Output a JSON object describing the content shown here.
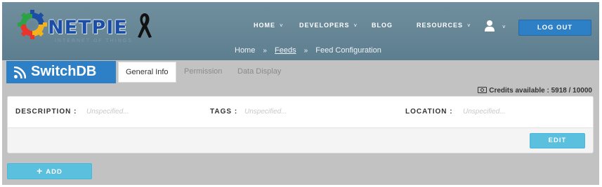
{
  "header": {
    "logo": {
      "text": "NETPIE",
      "tagline": "INTERNET OF THINGS"
    },
    "nav": [
      {
        "label": "HOME",
        "has_dropdown": true
      },
      {
        "label": "DEVELOPERS",
        "has_dropdown": true
      },
      {
        "label": "BLOG",
        "has_dropdown": false
      },
      {
        "label": "RESOURCES",
        "has_dropdown": true
      }
    ],
    "dropdown_caret": "˅",
    "user_icon": "user-icon",
    "logout_label": "LOG OUT"
  },
  "breadcrumb": {
    "items": [
      "Home",
      "Feeds",
      "Feed Configuration"
    ],
    "separator": "»"
  },
  "feed": {
    "title": "SwitchDB",
    "icon": "rss-icon"
  },
  "tabs": [
    {
      "label": "General Info",
      "active": true
    },
    {
      "label": "Permission",
      "active": false
    },
    {
      "label": "Data Display",
      "active": false
    }
  ],
  "credits": {
    "text": "Credits available : 5918 / 10000",
    "available": 5918,
    "total": 10000
  },
  "info": {
    "description_label": "DESCRIPTION :",
    "description_value": "Unspecified...",
    "tags_label": "TAGS :",
    "tags_value": "Unspecified...",
    "location_label": "LOCATION :",
    "location_value": "Unspecified...",
    "edit_label": "EDIT"
  },
  "add_button": {
    "plus": "+",
    "label": "ADD"
  },
  "colors": {
    "header_bg": "#668696",
    "brand_blue": "#2e80c6",
    "info_button": "#5bc0de",
    "page_bg": "#c2c2c2"
  }
}
